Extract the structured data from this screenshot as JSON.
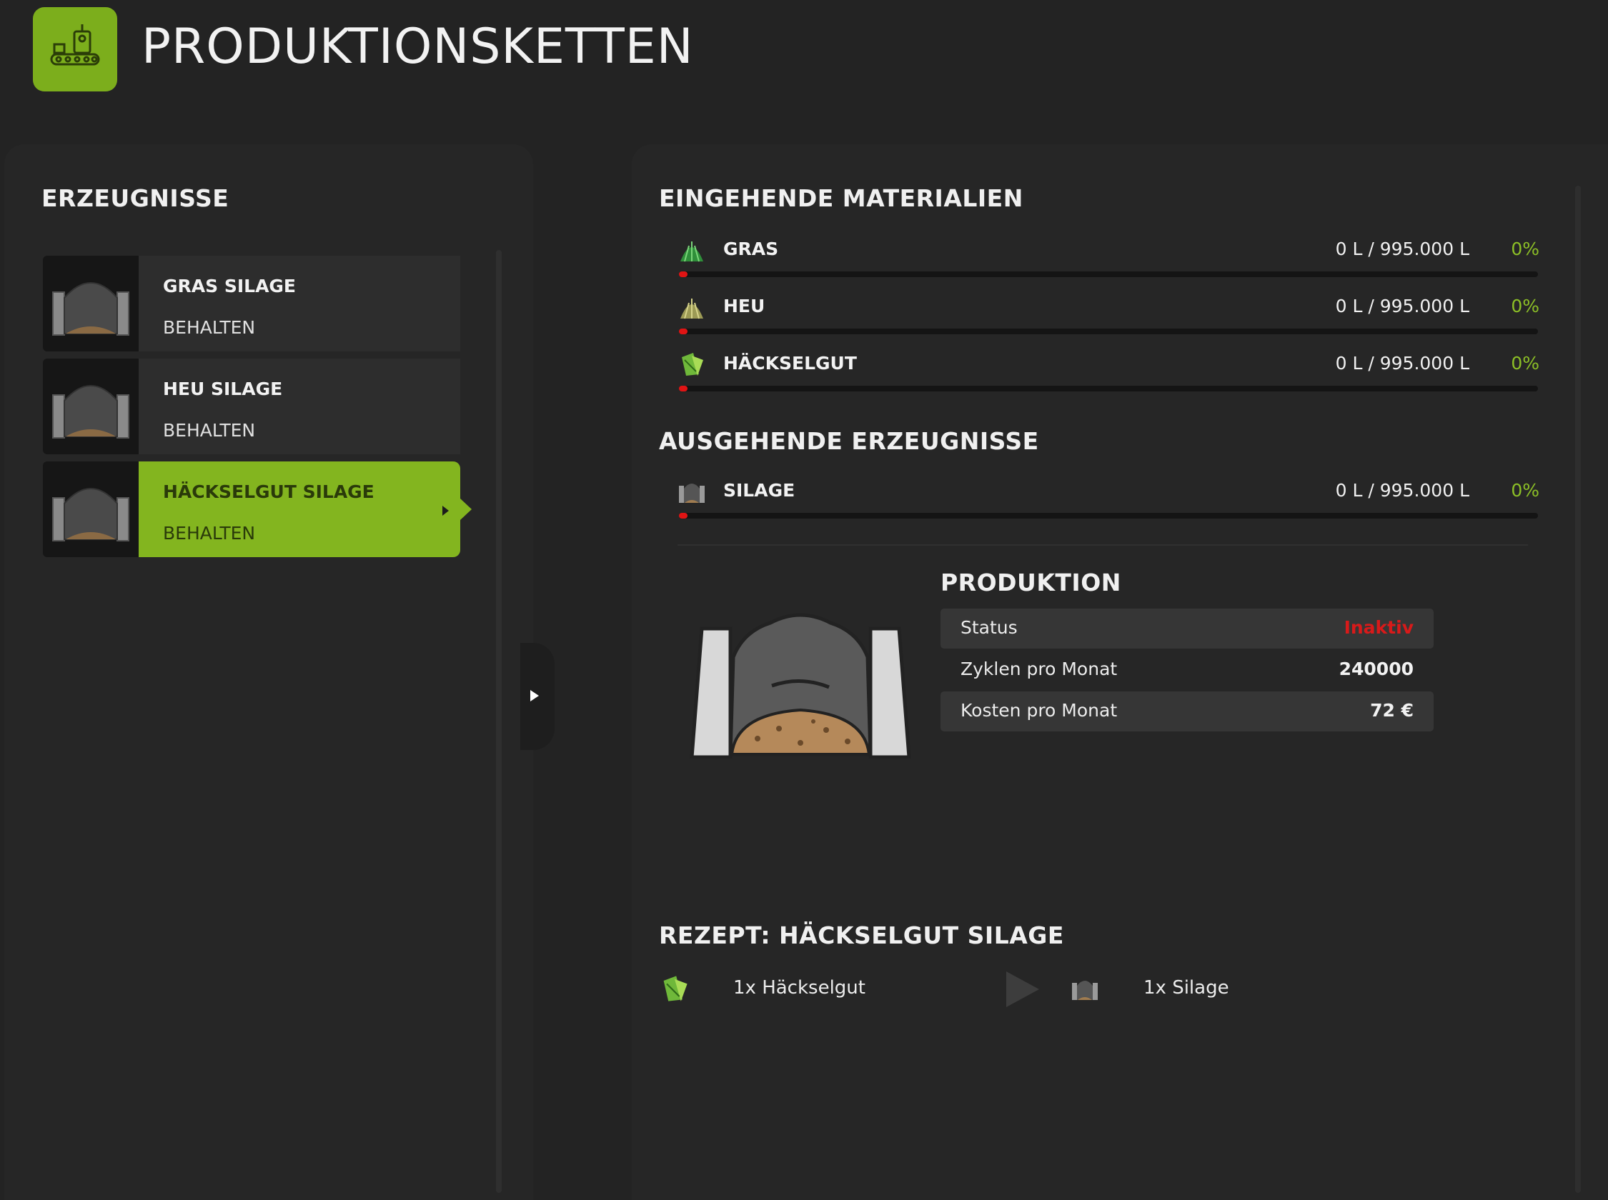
{
  "header": {
    "title": "PRODUKTIONSKETTEN",
    "logo_icon": "factory-icon"
  },
  "colors": {
    "accent": "#83b51f",
    "logo": "#7cae1c",
    "inactive": "#d81a1a",
    "bar_fill": "#e01414",
    "percent": "#8cbf26"
  },
  "products": {
    "title": "ERZEUGNISSE",
    "items": [
      {
        "name": "GRAS SILAGE",
        "status": "BEHALTEN",
        "icon": "silo-icon",
        "selected": false
      },
      {
        "name": "HEU SILAGE",
        "status": "BEHALTEN",
        "icon": "silo-icon",
        "selected": false
      },
      {
        "name": "HÄCKSELGUT SILAGE",
        "status": "BEHALTEN",
        "icon": "silo-icon",
        "selected": true
      }
    ]
  },
  "incoming": {
    "title": "EINGEHENDE MATERIALIEN",
    "items": [
      {
        "name": "GRAS",
        "amount": "0 L / 995.000 L",
        "percent": "0%",
        "fill": 0,
        "icon": "grass-icon"
      },
      {
        "name": "HEU",
        "amount": "0 L / 995.000 L",
        "percent": "0%",
        "fill": 0,
        "icon": "hay-icon"
      },
      {
        "name": "HÄCKSELGUT",
        "amount": "0 L / 995.000 L",
        "percent": "0%",
        "fill": 0,
        "icon": "chaff-icon"
      }
    ]
  },
  "outgoing": {
    "title": "AUSGEHENDE ERZEUGNISSE",
    "items": [
      {
        "name": "SILAGE",
        "amount": "0 L / 995.000 L",
        "percent": "0%",
        "fill": 0,
        "icon": "silage-icon"
      }
    ]
  },
  "production": {
    "title": "PRODUKTION",
    "status_label": "Status",
    "status_value": "Inaktiv",
    "cycles_label": "Zyklen pro Monat",
    "cycles_value": "240000",
    "cost_label": "Kosten pro Monat",
    "cost_value": "72 €"
  },
  "recipe": {
    "title": "REZEPT: HÄCKSELGUT SILAGE",
    "input": "1x Häckselgut",
    "output": "1x Silage"
  }
}
